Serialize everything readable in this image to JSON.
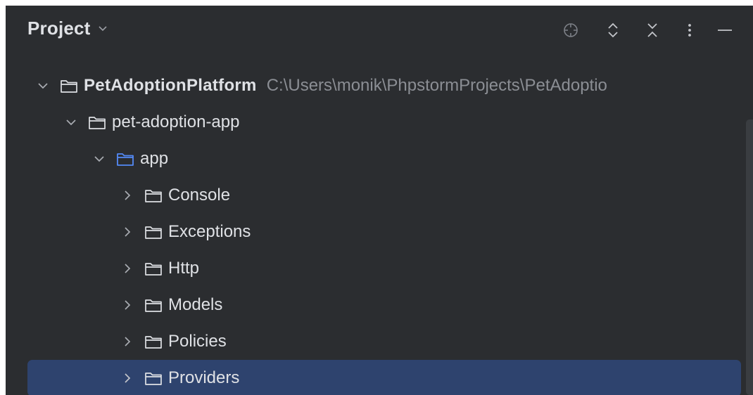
{
  "panel": {
    "title": "Project",
    "toolbar": {
      "icons": [
        "locate-icon",
        "expand-all-icon",
        "collapse-all-icon",
        "more-options-icon",
        "hide-icon"
      ]
    }
  },
  "tree": {
    "root": {
      "label": "PetAdoptionPlatform",
      "path": "C:\\Users\\monik\\PhpstormProjects\\PetAdoptio"
    },
    "app_project": {
      "label": "pet-adoption-app"
    },
    "app_folder": {
      "label": "app"
    },
    "children": [
      {
        "label": "Console"
      },
      {
        "label": "Exceptions"
      },
      {
        "label": "Http"
      },
      {
        "label": "Models"
      },
      {
        "label": "Policies"
      },
      {
        "label": "Providers"
      }
    ]
  },
  "colors": {
    "background": "#2b2d30",
    "selection": "#2e436e",
    "text": "#dfe1e5",
    "muted_text": "#8b8e94",
    "source_folder": "#548af7"
  }
}
